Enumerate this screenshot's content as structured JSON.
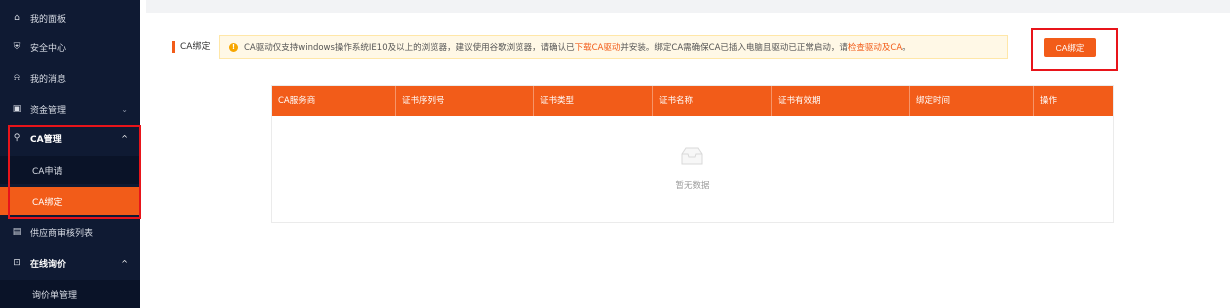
{
  "sidebar": {
    "items": [
      {
        "label": "我的面板",
        "icon": "home-icon",
        "glyph": "⌂"
      },
      {
        "label": "安全中心",
        "icon": "shield-icon",
        "glyph": "⛨"
      },
      {
        "label": "我的消息",
        "icon": "bell-icon",
        "glyph": "⍾"
      },
      {
        "label": "资金管理",
        "icon": "wallet-icon",
        "glyph": "▣"
      },
      {
        "label": "CA管理",
        "icon": "usb-key-icon",
        "glyph": "⚲"
      },
      {
        "label": "CA申请"
      },
      {
        "label": "CA绑定"
      },
      {
        "label": "供应商审核列表",
        "icon": "document-icon",
        "glyph": "▤"
      },
      {
        "label": "在线询价",
        "icon": "monitor-icon",
        "glyph": "⊡"
      },
      {
        "label": "询价单管理"
      }
    ]
  },
  "main": {
    "section_title": "CA绑定",
    "notice": {
      "part1": "CA驱动仅支持windows操作系统IE10及以上的浏览器，建议使用谷歌浏览器，请确认已",
      "link1": "下载CA驱动",
      "part2": "并安装。绑定CA需确保CA已插入电脑且驱动已正常启动，请",
      "link2": "检查驱动及CA",
      "part3": "。"
    },
    "bind_button": "CA绑定",
    "table": {
      "headers": [
        "CA服务商",
        "证书序列号",
        "证书类型",
        "证书名称",
        "证书有效期",
        "绑定时间",
        "操作"
      ],
      "empty_text": "暂无数据"
    }
  },
  "colors": {
    "accent": "#f25c19",
    "sidebar_bg": "#0f1a33",
    "highlight_border": "#e8141a"
  }
}
